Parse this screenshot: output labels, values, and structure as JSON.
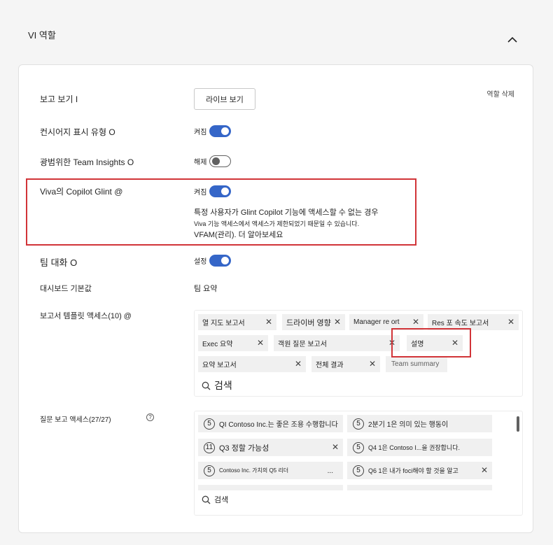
{
  "section": {
    "title": "VI 역할"
  },
  "card": {
    "delete_role": "역할 삭제",
    "report_view": {
      "label": "보고 보기 I",
      "button": "라이브 보기"
    },
    "consumer_display": {
      "label": "컨시어지 표시 유형 O",
      "state": "켜짐"
    },
    "team_insights": {
      "label": "광범위한 Team Insights O",
      "state": "해제"
    },
    "copilot": {
      "label": "Viva의 Copilot Glint @",
      "state": "켜짐",
      "desc1": "특정 사용자가 Glint Copilot 기능에 액세스할 수 없는 경우",
      "desc2": "Viva 기능 액세스에서 액세스가 제한되었기 때문일 수 있습니다.",
      "desc3": "VFAM(관리). 더 알아보세요"
    },
    "team_conversation": {
      "label": "팀 대화 O",
      "state": "설정"
    },
    "dashboard_default": {
      "label": "대시보드 기본값",
      "value": "팀 요약"
    },
    "report_templates": {
      "label": "보고서 템플릿 액세스(10) @",
      "chips": [
        "열 지도 보고서",
        "드라이버 영향",
        "Manager re ort",
        "Res 포 속도 보고서",
        "Exec 요약",
        "객원 질문 보고서",
        "설명",
        "요약 보고서",
        "전체 결과",
        "Team summary"
      ],
      "search": "검색"
    },
    "question_reports": {
      "label": "질문 보고 액세스(27/27)",
      "help": "?",
      "chips": [
        {
          "n": "5",
          "text": "QI Contoso Inc.는 좋은 조용 수행합니다"
        },
        {
          "n": "5",
          "text": "2분기 1은 의미 있는 행동이"
        },
        {
          "n": "11",
          "text": "Q3 정할 가능성"
        },
        {
          "n": "5",
          "text": "Q4 1은 Contoso I...을 권장합니다."
        },
        {
          "n": "5",
          "text": "Contoso Inc. 가치의 Q5 리더"
        },
        {
          "n": "5",
          "text": "Q6 1은 내가 foci해야 할 것을 알고"
        }
      ],
      "more": "...",
      "search": "검색"
    }
  }
}
